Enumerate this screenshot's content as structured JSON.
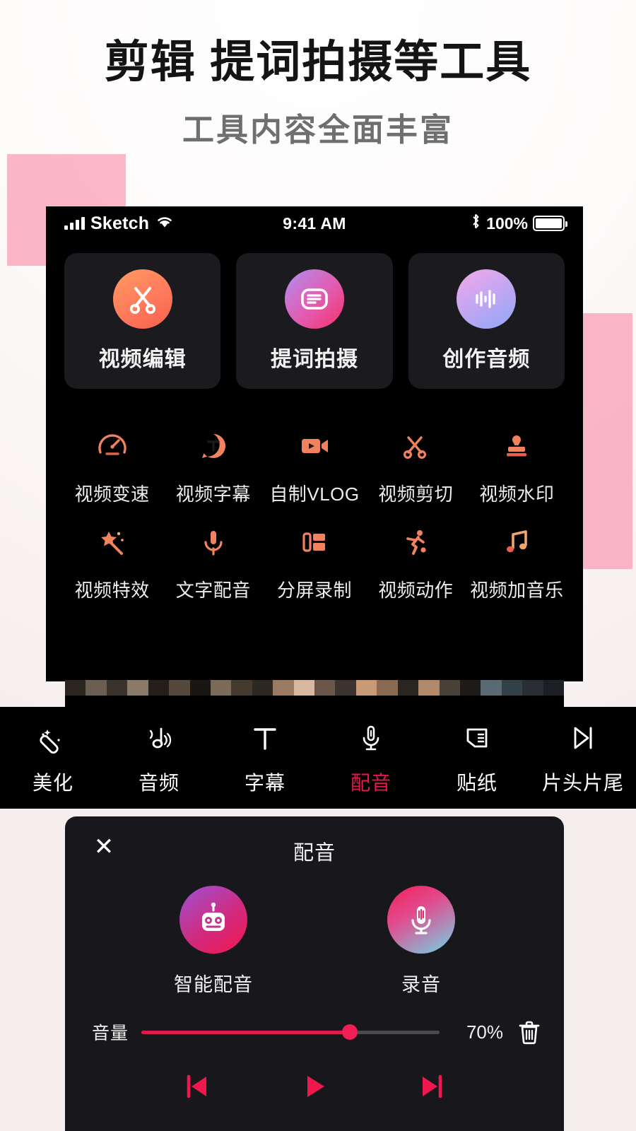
{
  "page": {
    "title": "剪辑 提词拍摄等工具",
    "subtitle": "工具内容全面丰富"
  },
  "colors": {
    "accent_red": "#e8174a",
    "slider_red": "#e01a4f",
    "deco_pink": "#fa8ca8",
    "screen_bg": "#000000",
    "panel_bg": "#18181c",
    "card_bg": "#1b1b1f",
    "icon_orange": "#ff7a5c"
  },
  "status_bar": {
    "signal_icon": "signal-bars-icon",
    "carrier": "Sketch",
    "wifi_icon": "wifi-icon",
    "time": "9:41 AM",
    "bluetooth_icon": "bluetooth-icon",
    "battery_percent": "100%",
    "battery_icon": "battery-full-icon"
  },
  "feature_cards": [
    {
      "label": "视频编辑",
      "icon": "scissors-icon"
    },
    {
      "label": "提词拍摄",
      "icon": "teleprompter-icon"
    },
    {
      "label": "创作音频",
      "icon": "waveform-icon"
    }
  ],
  "tool_grid": {
    "row1": [
      {
        "label": "视频变速",
        "icon": "speedometer-icon"
      },
      {
        "label": "视频字幕",
        "icon": "text-bubble-icon"
      },
      {
        "label": "自制VLOG",
        "icon": "video-camera-icon"
      },
      {
        "label": "视频剪切",
        "icon": "scissors-icon"
      },
      {
        "label": "视频水印",
        "icon": "stamp-icon"
      }
    ],
    "row2": [
      {
        "label": "视频特效",
        "icon": "magic-wand-icon"
      },
      {
        "label": "文字配音",
        "icon": "microphone-icon"
      },
      {
        "label": "分屏录制",
        "icon": "split-screen-icon"
      },
      {
        "label": "视频动作",
        "icon": "running-person-icon"
      },
      {
        "label": "视频加音乐",
        "icon": "music-note-icon"
      }
    ]
  },
  "toolbar": [
    {
      "label": "美化",
      "icon": "magic-wand-icon",
      "active": false
    },
    {
      "label": "音频",
      "icon": "audio-note-icon",
      "active": false
    },
    {
      "label": "字幕",
      "icon": "text-t-icon",
      "active": false
    },
    {
      "label": "配音",
      "icon": "microphone-icon",
      "active": true
    },
    {
      "label": "贴纸",
      "icon": "sticker-icon",
      "active": false
    },
    {
      "label": "片头片尾",
      "icon": "skip-end-icon",
      "active": false
    }
  ],
  "dubbing_panel": {
    "close_label": "✕",
    "title": "配音",
    "options": [
      {
        "label": "智能配音",
        "icon": "robot-icon"
      },
      {
        "label": "录音",
        "icon": "microphone-record-icon"
      }
    ],
    "volume": {
      "label": "音量",
      "value_text": "70%",
      "percent": 70,
      "delete_icon": "trash-icon"
    },
    "playback": [
      {
        "name": "previous",
        "icon": "skip-previous-icon"
      },
      {
        "name": "play",
        "icon": "play-icon"
      },
      {
        "name": "next",
        "icon": "skip-next-icon"
      }
    ]
  }
}
